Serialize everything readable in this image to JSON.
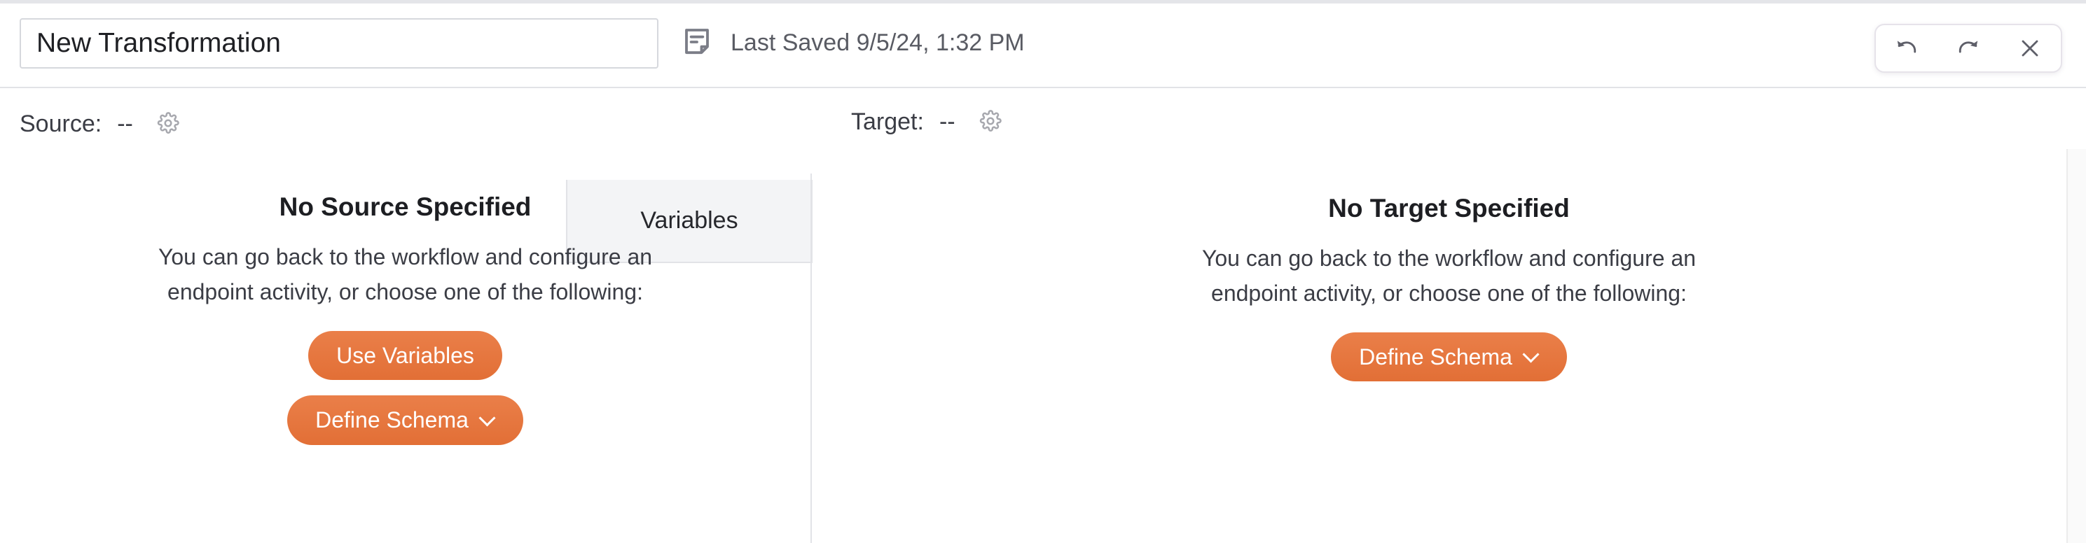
{
  "header": {
    "title_value": "New Transformation",
    "title_placeholder": "Transformation name",
    "note_icon": "note-icon",
    "last_saved": "Last Saved 9/5/24, 1:32 PM",
    "history": {
      "undo_icon": "undo-icon",
      "redo_icon": "redo-icon",
      "close_icon": "close-icon"
    }
  },
  "subbar": {
    "source": {
      "label": "Source:",
      "value": "--",
      "gear_icon": "gear-icon"
    },
    "target": {
      "label": "Target:",
      "value": "--",
      "gear_icon": "gear-icon"
    },
    "variables_tab": "Variables"
  },
  "source_panel": {
    "title": "No Source Specified",
    "description": "You can go back to the workflow and configure an endpoint activity, or choose one of the following:",
    "use_variables_label": "Use Variables",
    "define_schema_label": "Define Schema",
    "chevron_icon": "chevron-down-icon"
  },
  "target_panel": {
    "title": "No Target Specified",
    "description": "You can go back to the workflow and configure an endpoint activity, or choose one of the following:",
    "define_schema_label": "Define Schema",
    "chevron_icon": "chevron-down-icon"
  },
  "colors": {
    "accent": "#e2753c",
    "border": "#e2e3e7",
    "text": "#3b3d45",
    "tab_bg": "#f3f4f6"
  }
}
